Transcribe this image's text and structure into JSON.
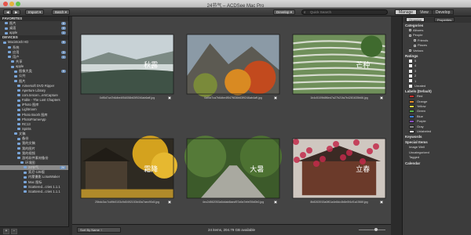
{
  "window": {
    "title": "24节气 – ACDSee Mac Pro"
  },
  "toolbar": {
    "import_label": "Import ▾",
    "batch_label": "Batch ▾",
    "develop_label": "Develop ▾",
    "search_placeholder": "Quick Search",
    "modes": [
      "Manage",
      "View",
      "Develop"
    ]
  },
  "sidebar": {
    "favorites_header": "FAVORITES",
    "favorites": [
      {
        "label": "图片",
        "count": "6"
      },
      {
        "label": "桌面",
        "count": "4"
      },
      {
        "label": "apple",
        "count": "1"
      }
    ],
    "devices_header": "DEVICES",
    "tree": [
      {
        "label": "Macintosh HD",
        "count": "9"
      },
      {
        "label": "系统",
        "count": ""
      },
      {
        "label": "应用",
        "count": "3"
      },
      {
        "label": "用户",
        "count": "1"
      },
      {
        "label": "共享",
        "count": ""
      },
      {
        "label": "apple",
        "count": ""
      },
      {
        "label": "图像大类",
        "count": "9"
      },
      {
        "label": "公共",
        "count": ""
      },
      {
        "label": "图片",
        "count": ""
      },
      {
        "label": "Aimersoft DVD Ripper",
        "count": ""
      },
      {
        "label": "Aperture Library",
        "count": ""
      },
      {
        "label": "com.tencen...ersCapture",
        "count": ""
      },
      {
        "label": "Fable - The Lost Chapters",
        "count": ""
      },
      {
        "label": "iPhoto 图库",
        "count": ""
      },
      {
        "label": "Lightroom",
        "count": ""
      },
      {
        "label": "Photo Booth 图库",
        "count": ""
      },
      {
        "label": "PhotoFrameApp",
        "count": ""
      },
      {
        "label": "RC13",
        "count": ""
      },
      {
        "label": "Spirits",
        "count": ""
      },
      {
        "label": "文稿",
        "count": ""
      },
      {
        "label": "备份",
        "count": ""
      },
      {
        "label": "我的文稿",
        "count": ""
      },
      {
        "label": "我的图片",
        "count": ""
      },
      {
        "label": "我的视频",
        "count": ""
      },
      {
        "label": "游戏软件素材备份",
        "count": ""
      },
      {
        "label": "环境图",
        "count": ""
      },
      {
        "label": "24节气",
        "count": "24"
      },
      {
        "label": "索尼-135版",
        "count": ""
      },
      {
        "label": "内蒙摄影 LotusWaker",
        "count": ""
      },
      {
        "label": "Mac 图标",
        "count": ""
      },
      {
        "label": "Scattered...cries 1.1.1",
        "count": ""
      },
      {
        "label": "Scattered...cries 1.1.1",
        "count": ""
      }
    ],
    "selected_item": "24节气"
  },
  "grid": {
    "items": [
      {
        "caption": "0df5d7ca7b6dbe4f54836b63f9246ab6aff.jpg",
        "theme": "mist",
        "text": "秋露"
      },
      {
        "caption": "0df5d7ca7b6dbe4f547f836b63f9246ab4aff.jpg",
        "theme": "autumn",
        "text": ""
      },
      {
        "caption": "1b4c5109b8f6ed7a27b21fa7b4281635b66.jpg",
        "theme": "terrace",
        "text": "芒种"
      },
      {
        "caption": "25bdc3cc7cd9b0103c9d0492153b40a7aec90c5.jpg",
        "theme": "ginkgo",
        "text": "霜降"
      },
      {
        "caption": "4ec2d562053a5ddab8aecf57a9a7efef39d0b0.jpg",
        "theme": "road",
        "text": "大暑"
      },
      {
        "caption": "8b8263915a0f61a4e8dc4b8e0f4cf1a1566f.jpg",
        "theme": "plum",
        "text": "立春"
      }
    ]
  },
  "bottom": {
    "sort_label": "Sort By Name ↑",
    "status": "24 items, 204.79 GB available"
  },
  "rpanel": {
    "tabs": [
      "Organize",
      "Properties"
    ],
    "categories_header": "Categories",
    "categories": [
      "Albums",
      "People",
      "Friends",
      "Places",
      "Various"
    ],
    "ratings_header": "Ratings",
    "ratings": [
      "5",
      "4",
      "3",
      "2",
      "1",
      "Unrated"
    ],
    "labels_header": "Labels (Default)",
    "labels": [
      {
        "name": "Red",
        "color": "#c9302c"
      },
      {
        "name": "Orange",
        "color": "#e58a2a"
      },
      {
        "name": "Yellow",
        "color": "#e6d33a"
      },
      {
        "name": "Green",
        "color": "#5bb44a"
      },
      {
        "name": "Blue",
        "color": "#3d7fd6"
      },
      {
        "name": "Purple",
        "color": "#8a4fc4"
      },
      {
        "name": "Gray",
        "color": "#8c8c8c"
      },
      {
        "name": "Unlabeled",
        "color": "#ffffff"
      }
    ],
    "keywords_header": "Keywords",
    "special_header": "Special Items",
    "special": [
      "Image Well",
      "Uncategorized",
      "Tagged"
    ],
    "calendar_header": "Calendar"
  }
}
